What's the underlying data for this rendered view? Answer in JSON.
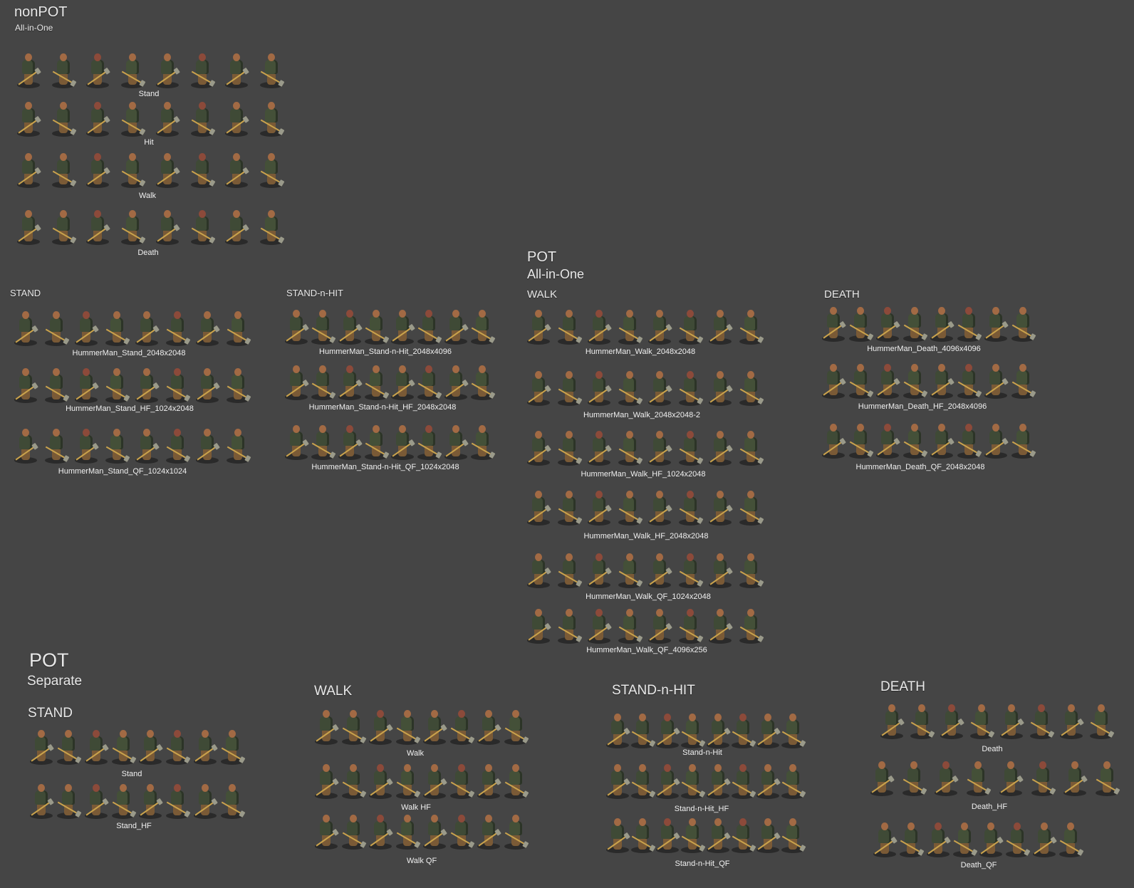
{
  "headings": {
    "nonpot_title": "nonPOT",
    "nonpot_subtitle": "All-in-One",
    "pot_aio_title": "POT",
    "pot_aio_subtitle": "All-in-One",
    "pot_sep_title": "POT",
    "pot_sep_subtitle": "Separate"
  },
  "nonpot": {
    "rows": [
      "Stand",
      "Hit",
      "Walk",
      "Death"
    ]
  },
  "pot_aio": {
    "stand": {
      "title": "STAND",
      "rows": [
        "HummerMan_Stand_2048x2048",
        "HummerMan_Stand_HF_1024x2048",
        "HummerMan_Stand_QF_1024x1024"
      ]
    },
    "stand_n_hit": {
      "title": "STAND-n-HIT",
      "rows": [
        "HummerMan_Stand-n-Hit_2048x4096",
        "HummerMan_Stand-n-Hit_HF_2048x2048",
        "HummerMan_Stand-n-Hit_QF_1024x2048"
      ]
    },
    "walk": {
      "title": "WALK",
      "rows": [
        "HummerMan_Walk_2048x2048",
        "HummerMan_Walk_2048x2048-2",
        "HummerMan_Walk_HF_1024x2048",
        "HummerMan_Walk_HF_2048x2048",
        "HummerMan_Walk_QF_1024x2048",
        "HummerMan_Walk_QF_4096x256"
      ]
    },
    "death": {
      "title": "DEATH",
      "rows": [
        "HummerMan_Death_4096x4096",
        "HummerMan_Death_HF_2048x4096",
        "HummerMan_Death_QF_2048x2048"
      ]
    }
  },
  "pot_sep": {
    "stand": {
      "title": "STAND",
      "rows": [
        "Stand",
        "Stand_HF"
      ]
    },
    "walk": {
      "title": "WALK",
      "rows": [
        "Walk",
        "Walk HF",
        "Walk QF"
      ]
    },
    "stand_n_hit": {
      "title": "STAND-n-HIT",
      "rows": [
        "Stand-n-Hit",
        "Stand-n-Hit_HF",
        "Stand-n-Hit_QF"
      ]
    },
    "death": {
      "title": "DEATH",
      "rows": [
        "Death",
        "Death_HF",
        "Death_QF"
      ]
    }
  }
}
